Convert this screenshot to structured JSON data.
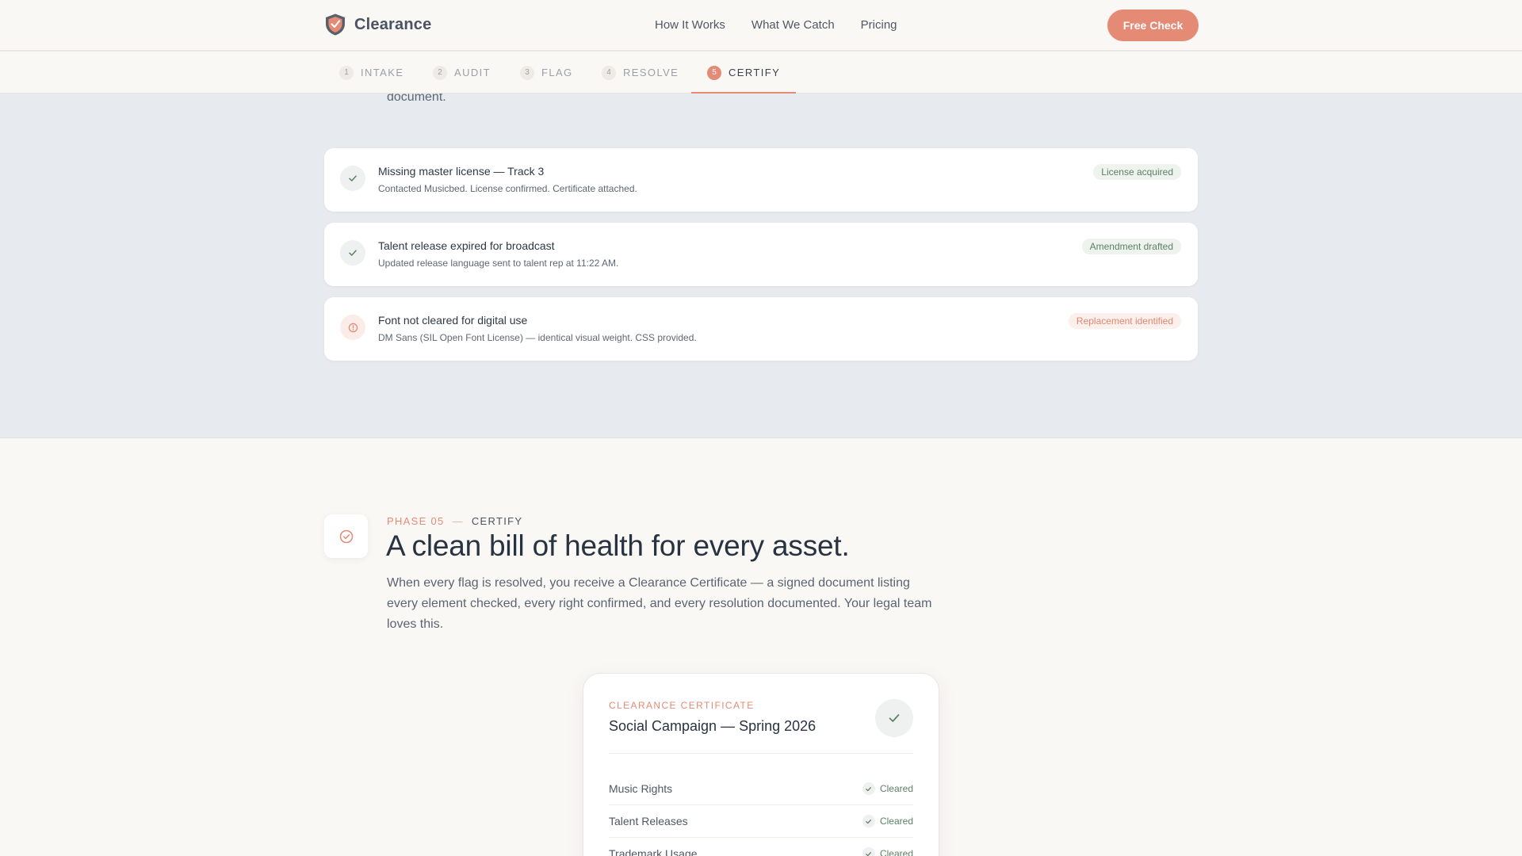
{
  "header": {
    "brand": "Clearance",
    "nav": [
      "How It Works",
      "What We Catch",
      "Pricing"
    ],
    "cta": "Free Check"
  },
  "steps": [
    {
      "num": "1",
      "label": "INTAKE"
    },
    {
      "num": "2",
      "label": "AUDIT"
    },
    {
      "num": "3",
      "label": "FLAG"
    },
    {
      "num": "4",
      "label": "RESOLVE"
    },
    {
      "num": "5",
      "label": "CERTIFY"
    }
  ],
  "flag_section": {
    "previous_text_tail": "document.",
    "items": [
      {
        "title": "Missing master license — Track 3",
        "desc": "Contacted Musicbed. License confirmed. Certificate attached.",
        "badge": "License acquired",
        "status": "ok"
      },
      {
        "title": "Talent release expired for broadcast",
        "desc": "Updated release language sent to talent rep at 11:22 AM.",
        "badge": "Amendment drafted",
        "status": "ok"
      },
      {
        "title": "Font not cleared for digital use",
        "desc": "DM Sans (SIL Open Font License) — identical visual weight. CSS provided.",
        "badge": "Replacement identified",
        "status": "warn"
      }
    ]
  },
  "certify": {
    "phase": "PHASE 05",
    "dash": "—",
    "name": "CERTIFY",
    "headline": "A clean bill of health for every asset.",
    "lead": "When every flag is resolved, you receive a Clearance Certificate — a signed document listing every element checked, every right confirmed, and every resolution documented. Your legal team loves this.",
    "certificate": {
      "label": "CLEARANCE CERTIFICATE",
      "title": "Social Campaign — Spring 2026",
      "rows": [
        {
          "label": "Music Rights",
          "status": "Cleared"
        },
        {
          "label": "Talent Releases",
          "status": "Cleared"
        },
        {
          "label": "Trademark Usage",
          "status": "Cleared"
        }
      ]
    }
  },
  "colors": {
    "accent": "#e48a75",
    "success": "#5c7f65",
    "section_gray": "#e7eaee",
    "page_bg": "#faf8f5"
  },
  "icons": {
    "logo": "shield-logo-icon",
    "resolved": "check-icon",
    "warning": "alert-circle-icon",
    "phase": "check-circle-icon"
  }
}
